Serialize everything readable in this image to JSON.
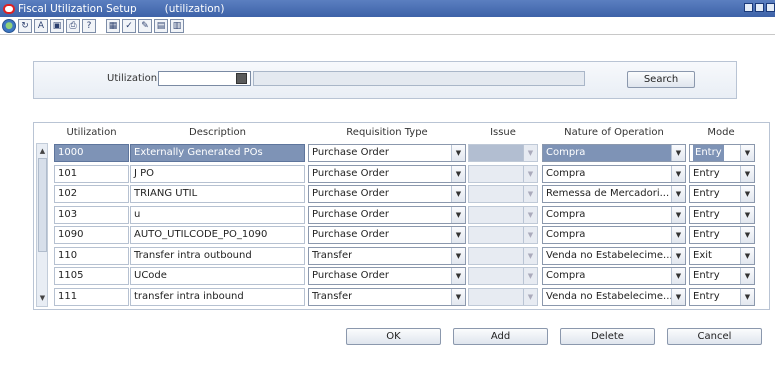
{
  "window": {
    "title": "Fiscal Utilization Setup",
    "subtitle": "(utilization)"
  },
  "toolbar": {
    "icons": [
      "globe-icon",
      "refresh-icon",
      "ab-icon",
      "copy-icon",
      "print-icon",
      "help-icon",
      "grid-icon",
      "check-icon",
      "notes-icon",
      "chart-icon",
      "chart2-icon"
    ]
  },
  "search": {
    "label": "Utilization",
    "value": "",
    "button_label": "Search"
  },
  "table": {
    "headers": {
      "utilization": "Utilization",
      "description": "Description",
      "requisition_type": "Requisition Type",
      "issue": "Issue",
      "nature": "Nature of Operation",
      "mode": "Mode"
    },
    "rows": [
      {
        "utilization": "1000",
        "description": "Externally Generated POs",
        "requisition_type": "Purchase Order",
        "issue": "",
        "nature": "Compra",
        "mode": "Entry"
      },
      {
        "utilization": "101",
        "description": "J PO",
        "requisition_type": "Purchase Order",
        "issue": "",
        "nature": "Compra",
        "mode": "Entry"
      },
      {
        "utilization": "102",
        "description": "TRIANG UTIL",
        "requisition_type": "Purchase Order",
        "issue": "",
        "nature": "Remessa de Mercadori...",
        "mode": "Entry"
      },
      {
        "utilization": "103",
        "description": "u",
        "requisition_type": "Purchase Order",
        "issue": "",
        "nature": "Compra",
        "mode": "Entry"
      },
      {
        "utilization": "1090",
        "description": "AUTO_UTILCODE_PO_1090",
        "requisition_type": "Purchase Order",
        "issue": "",
        "nature": "Compra",
        "mode": "Entry"
      },
      {
        "utilization": "110",
        "description": "Transfer intra outbound",
        "requisition_type": "Transfer",
        "issue": "",
        "nature": "Venda no Estabelecime...",
        "mode": "Exit"
      },
      {
        "utilization": "1105",
        "description": "UCode",
        "requisition_type": "Purchase Order",
        "issue": "",
        "nature": "Compra",
        "mode": "Entry"
      },
      {
        "utilization": "111",
        "description": "transfer intra inbound",
        "requisition_type": "Transfer",
        "issue": "",
        "nature": "Venda no Estabelecime...",
        "mode": "Entry"
      }
    ]
  },
  "buttons": {
    "ok": "OK",
    "add": "Add",
    "delete": "Delete",
    "cancel": "Cancel"
  },
  "colors": {
    "titlebar": "#3d62a8",
    "selected_row": "#7e93b6"
  }
}
